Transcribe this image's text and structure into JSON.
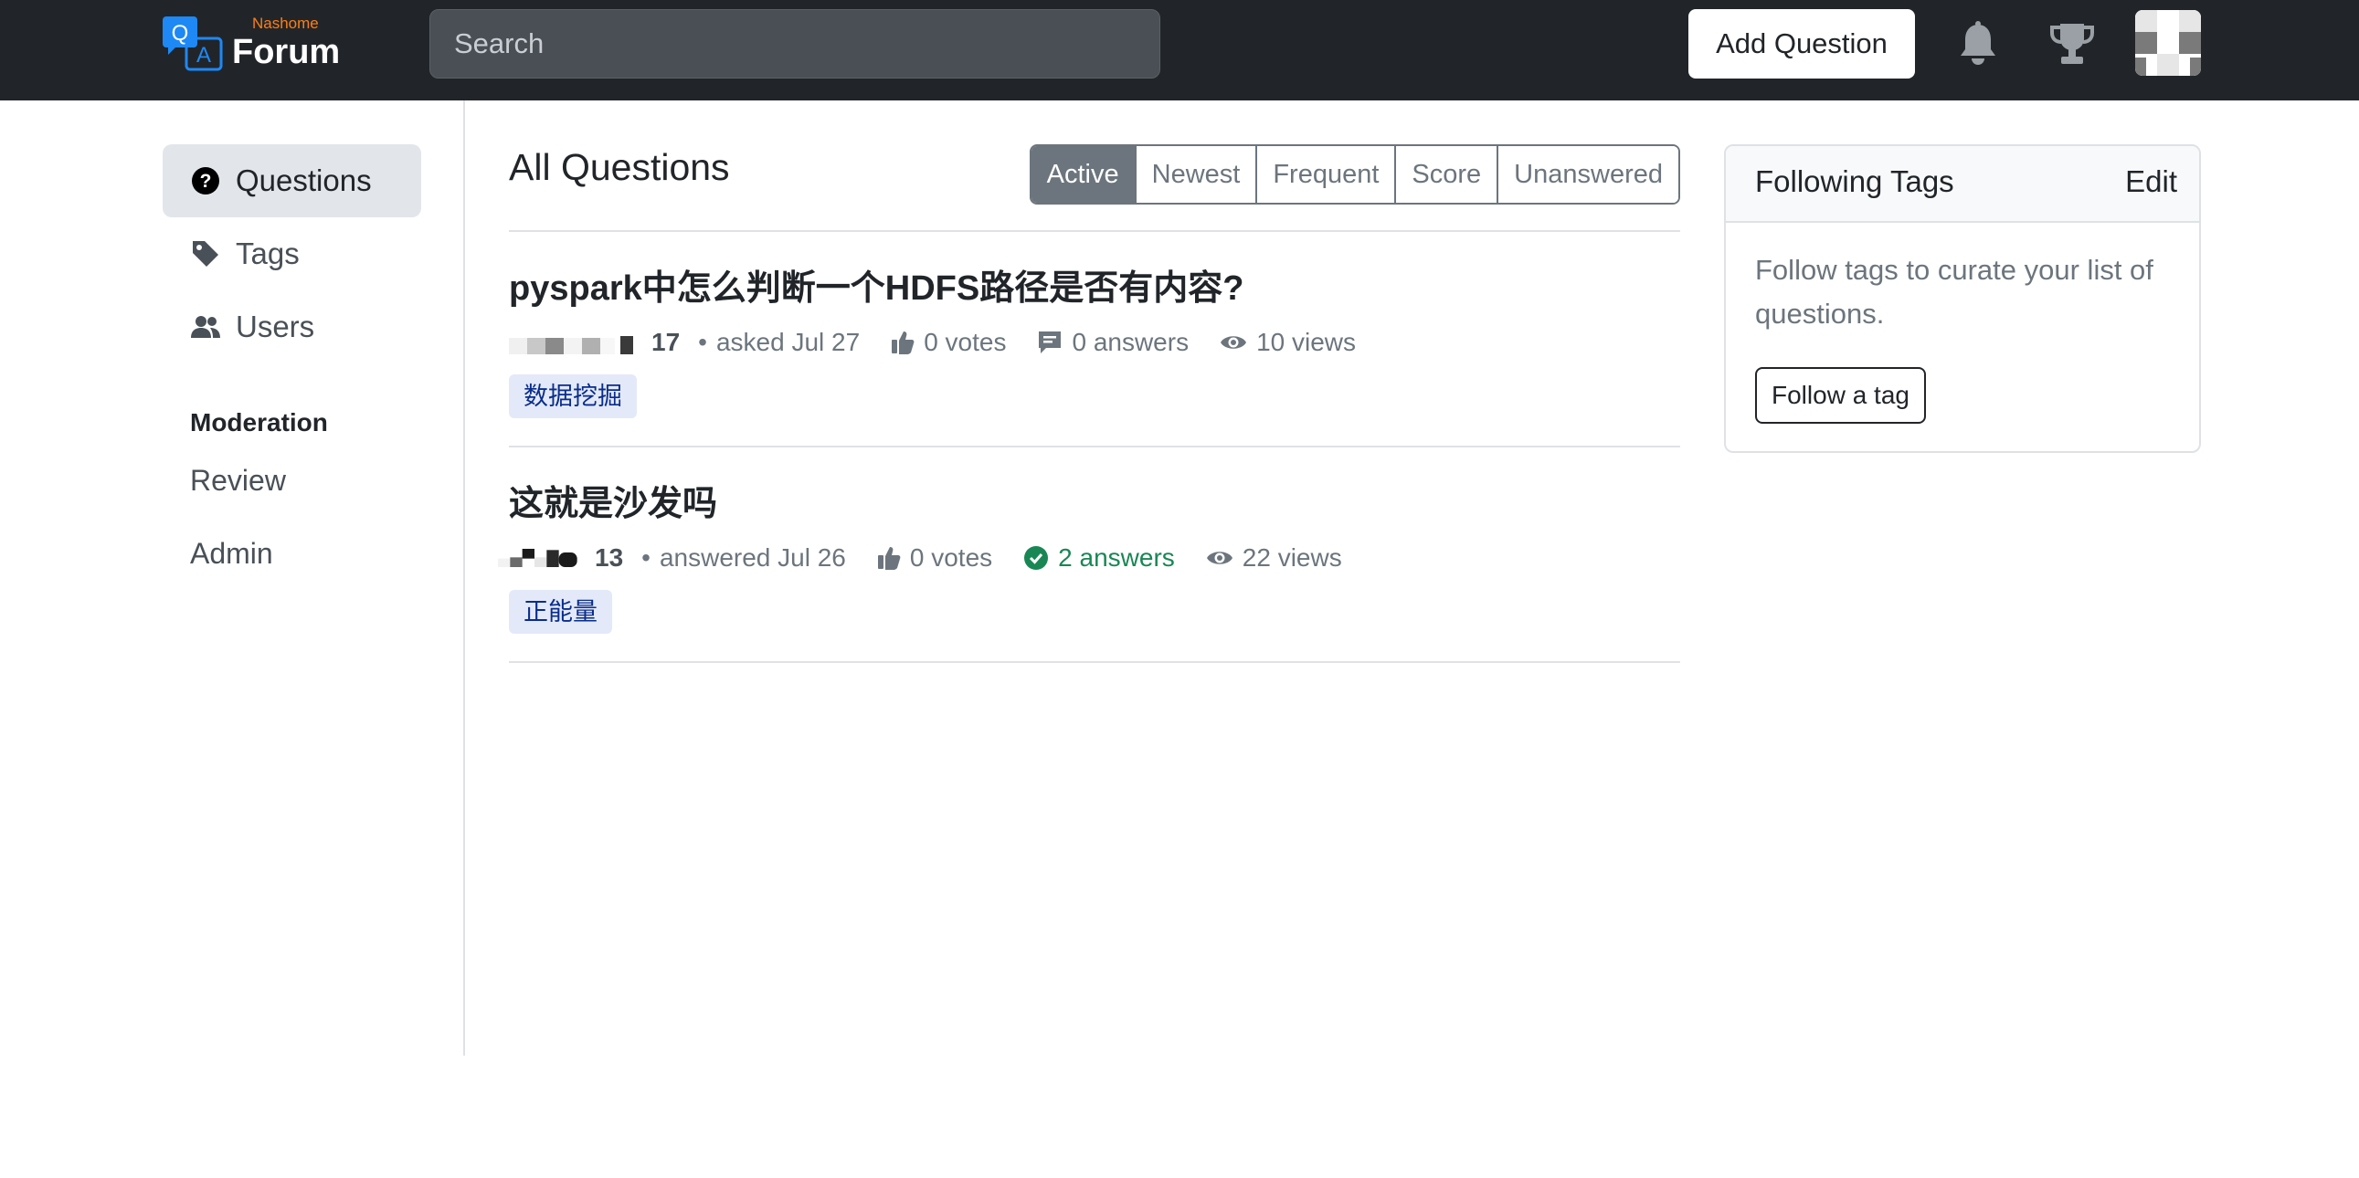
{
  "header": {
    "brand_sub": "Nashome",
    "brand_name": "Forum",
    "search_placeholder": "Search",
    "add_question_label": "Add Question",
    "colors": {
      "bar": "#212529",
      "brand_sub": "#fd7e14",
      "logo_blue": "#1e88f5"
    },
    "icons": [
      "bell-icon",
      "trophy-icon",
      "user-avatar"
    ]
  },
  "sidebar": {
    "items": [
      {
        "label": "Questions",
        "icon": "question-circle-icon",
        "active": true
      },
      {
        "label": "Tags",
        "icon": "tag-icon",
        "active": false
      },
      {
        "label": "Users",
        "icon": "people-icon",
        "active": false
      }
    ],
    "moderation": {
      "heading": "Moderation",
      "items": [
        "Review",
        "Admin"
      ]
    }
  },
  "main": {
    "title": "All Questions",
    "sort_tabs": [
      "Active",
      "Newest",
      "Frequent",
      "Score",
      "Unanswered"
    ],
    "active_sort": "Active",
    "questions": [
      {
        "title": "pyspark中怎么判断一个HDFS路径是否有内容?",
        "reputation": "17",
        "activity": "asked Jul 27",
        "votes": "0 votes",
        "answers": "0 answers",
        "answers_accepted": false,
        "views": "10 views",
        "tag": "数据挖掘"
      },
      {
        "title": "这就是沙发吗",
        "reputation": "13",
        "activity": "answered Jul 26",
        "votes": "0 votes",
        "answers": "2 answers",
        "answers_accepted": true,
        "views": "22 views",
        "tag": "正能量"
      }
    ]
  },
  "following_tags": {
    "title": "Following Tags",
    "edit_label": "Edit",
    "description": "Follow tags to curate your list of questions.",
    "button_label": "Follow a tag"
  }
}
